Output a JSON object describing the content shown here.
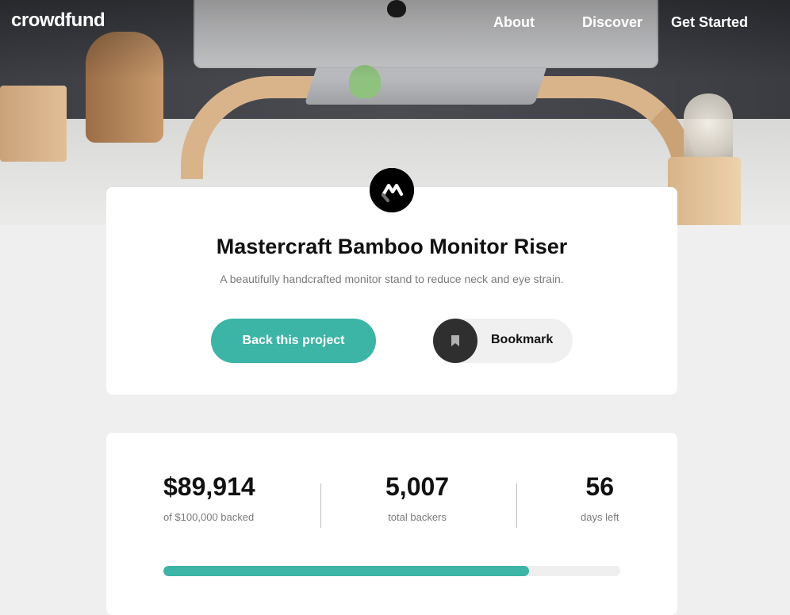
{
  "header": {
    "logo": "crowdfund",
    "nav": {
      "about": "About",
      "discover": "Discover",
      "get_started": "Get Started"
    }
  },
  "project": {
    "title": "Mastercraft Bamboo Monitor Riser",
    "description": "A beautifully handcrafted monitor stand to reduce neck and eye strain.",
    "back_button": "Back this project",
    "bookmark_label": "Bookmark"
  },
  "stats": {
    "backed_amount": "$89,914",
    "backed_label": "of $100,000 backed",
    "backers_count": "5,007",
    "backers_label": "total backers",
    "days_left": "56",
    "days_label": "days left",
    "progress_fraction": 0.8
  },
  "colors": {
    "accent": "#3cb4a6",
    "dark": "#2f2f2f",
    "background": "#efefef"
  },
  "icons": {
    "logo_mark": "mastercraft-logo-icon",
    "bookmark": "bookmark-icon"
  }
}
